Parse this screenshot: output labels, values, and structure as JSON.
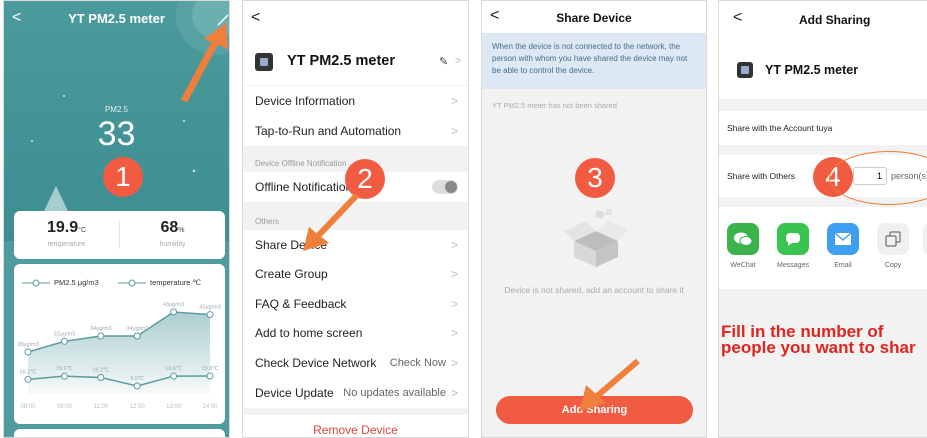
{
  "screen1": {
    "title": "YT PM2.5 meter",
    "pm_label": "PM2.5",
    "pm_value": "33",
    "step": "1",
    "temp_value": "19.9",
    "temp_unit": "°C",
    "temp_label": "temperature",
    "hum_value": "68",
    "hum_unit": "%",
    "hum_label": "humidity",
    "legend_pm": "PM2.5 μg/m3",
    "legend_temp": "temperature ℃"
  },
  "chart_data": {
    "type": "line",
    "categories": [
      "08:00",
      "09:00",
      "11:00",
      "12:00",
      "13:00",
      "14:00"
    ],
    "series": [
      {
        "name": "PM2.5 μg/m3",
        "values": [
          28,
          32,
          34,
          34,
          43,
          42
        ],
        "labels": [
          "28μg/m3",
          "32μg/m3",
          "34μg/m3",
          "34μg/m3",
          "43μg/m3",
          "42μg/m3"
        ]
      },
      {
        "name": "temperature ℃",
        "values": [
          16.2,
          19.6,
          18.2,
          9.0,
          19.6,
          19.8
        ],
        "labels": [
          "16.2℃",
          "19.6℃",
          "18.2℃",
          "9.0℃",
          "19.6℃",
          "19.8℃"
        ]
      }
    ]
  },
  "screen2": {
    "title": "YT PM2.5 meter",
    "step": "2",
    "rows": {
      "device_info": "Device Information",
      "tap_run": "Tap-to-Run and Automation",
      "offline_notif": "Offline Notification",
      "share": "Share Device",
      "group": "Create Group",
      "faq": "FAQ & Feedback",
      "home": "Add to home screen",
      "network": "Check Device Network",
      "network_val": "Check Now",
      "update": "Device Update",
      "update_val": "No updates available"
    },
    "section_offline": "Device Offline Notification",
    "section_others": "Others",
    "remove": "Remove Device"
  },
  "screen3": {
    "title": "Share Device",
    "notice": "When the device is not connected to the network, the person with whom you have shared the device may not be able to control the device.",
    "not_shared": "YT PM2.5 meter has not been shared",
    "empty_text": "Device is not shared, add an account to share it",
    "step": "3",
    "button": "Add Sharing"
  },
  "screen4": {
    "title": "Add Sharing",
    "device": "YT PM2.5 meter",
    "share_account": "Share with the Account tuya",
    "share_others": "Share with Others",
    "step": "4",
    "count": "1",
    "count_unit": "person(s)",
    "apps": {
      "wechat": "WeChat",
      "messages": "Messages",
      "email": "Email",
      "copy": "Copy"
    },
    "instruction_1": "Fill in the number of",
    "instruction_2": "people you want to shar"
  },
  "colors": {
    "accent": "#f05b41",
    "arrow": "#f07f3c",
    "teal": "#4f9b9d",
    "chart_line": "#5a9c9f"
  }
}
